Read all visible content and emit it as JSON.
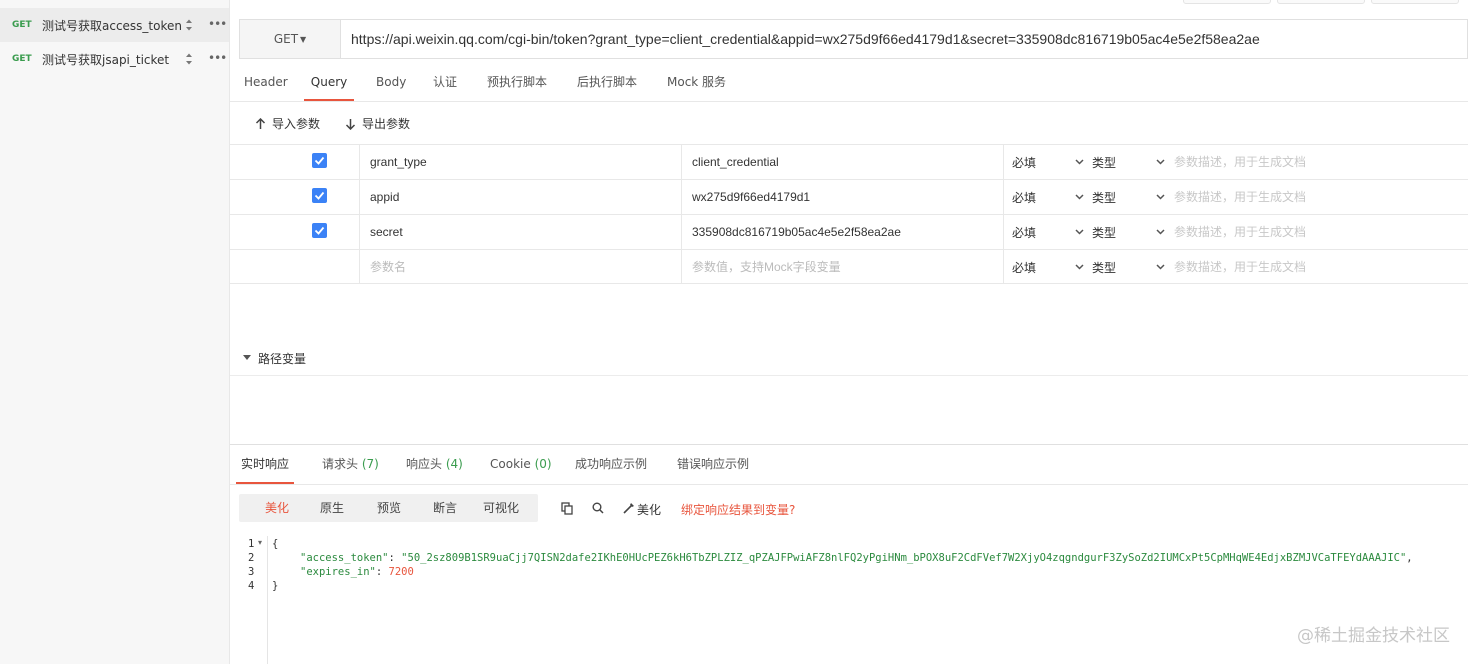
{
  "sidebar": {
    "items": [
      {
        "method": "GET",
        "name": "测试号获取access_token"
      },
      {
        "method": "GET",
        "name": "测试号获取jsapi_ticket"
      }
    ]
  },
  "request": {
    "method": "GET",
    "url": "https://api.weixin.qq.com/cgi-bin/token?grant_type=client_credential&appid=wx275d9f66ed4179d1&secret=335908dc816719b05ac4e5e2f58ea2ae"
  },
  "req_tabs": [
    "Header",
    "Query",
    "Body",
    "认证",
    "预执行脚本",
    "后执行脚本",
    "Mock 服务"
  ],
  "query": {
    "import_label": "导入参数",
    "export_label": "导出参数",
    "params": [
      {
        "name": "grant_type",
        "value": "client_credential",
        "required": "必填",
        "type": "类型",
        "desc_placeholder": "参数描述，用于生成文档"
      },
      {
        "name": "appid",
        "value": "wx275d9f66ed4179d1",
        "required": "必填",
        "type": "类型",
        "desc_placeholder": "参数描述，用于生成文档"
      },
      {
        "name": "secret",
        "value": "335908dc816719b05ac4e5e2f58ea2ae",
        "required": "必填",
        "type": "类型",
        "desc_placeholder": "参数描述，用于生成文档"
      }
    ],
    "new_row": {
      "name_placeholder": "参数名",
      "value_placeholder": "参数值，支持Mock字段变量",
      "required": "必填",
      "type": "类型",
      "desc_placeholder": "参数描述，用于生成文档"
    },
    "path_vars_label": "路径变量"
  },
  "response": {
    "tabs": [
      {
        "label": "实时响应",
        "count": ""
      },
      {
        "label": "请求头",
        "count": "(7)"
      },
      {
        "label": "响应头",
        "count": "(4)"
      },
      {
        "label": "Cookie",
        "count": "(0)"
      },
      {
        "label": "成功响应示例",
        "count": ""
      },
      {
        "label": "错误响应示例",
        "count": ""
      }
    ],
    "formats": [
      "美化",
      "原生",
      "预览",
      "断言",
      "可视化"
    ],
    "beautify_label": "美化",
    "bind_label": "绑定响应结果到变量?",
    "line_numbers": [
      "1",
      "2",
      "3",
      "4"
    ],
    "code": {
      "open": "{",
      "access_token_key": "\"access_token\"",
      "access_token_value": "\"50_2sz809B1SR9uaCjj7QISN2dafe2IKhE0HUcPEZ6kH6TbZPLZIZ_qPZAJFPwiAFZ8nlFQ2yPgiHNm_bPOX8uF2CdFVef7W2XjyO4zqgndgurF3ZySoZd2IUMCxPt5CpMHqWE4EdjxBZMJVCaTFEYdAAAJIC\"",
      "expires_in_key": "\"expires_in\"",
      "expires_in_value": "7200",
      "close": "}"
    }
  },
  "watermark": "@稀土掘金技术社区",
  "colors": {
    "accent": "#e8553d",
    "green": "#3a9c4e",
    "checkbox": "#3b82f6"
  }
}
